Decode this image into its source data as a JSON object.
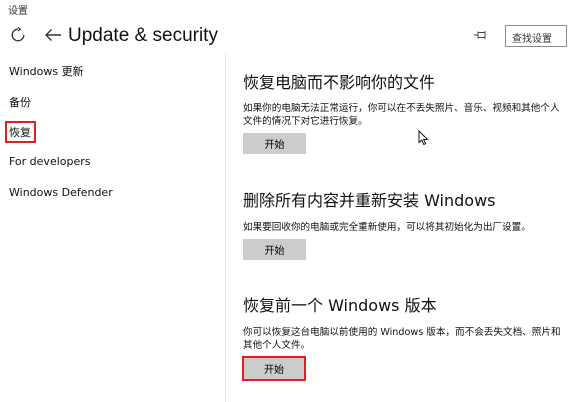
{
  "window": {
    "title": "设置"
  },
  "header": {
    "title": "Update & security",
    "search_placeholder": "查找设置"
  },
  "sidebar": {
    "items": [
      {
        "label": "Windows 更新"
      },
      {
        "label": "备份"
      },
      {
        "label": "恢复"
      },
      {
        "label": "For developers"
      },
      {
        "label": "Windows Defender"
      }
    ]
  },
  "main": {
    "sections": [
      {
        "title": "恢复电脑而不影响你的文件",
        "description": "如果你的电脑无法正常运行，你可以在不丢失照片、音乐、视频和其他个人文件的情况下对它进行恢复。",
        "button_label": "开始"
      },
      {
        "title": "删除所有内容并重新安装 Windows",
        "description": "如果要回收你的电脑或完全重新使用，可以将其初始化为出厂设置。",
        "button_label": "开始"
      },
      {
        "title": "恢复前一个 Windows 版本",
        "description": "你可以恢复这台电脑以前使用的 Windows 版本，而不会丢失文档、照片和其他个人文件。",
        "button_label": "开始"
      }
    ]
  },
  "colors": {
    "highlight_border": "#e02020",
    "button_bg": "#cccccc"
  },
  "icons": {
    "refresh": "refresh-icon",
    "back": "back-arrow-icon",
    "pin": "pin-icon",
    "cursor": "mouse-cursor-icon"
  }
}
